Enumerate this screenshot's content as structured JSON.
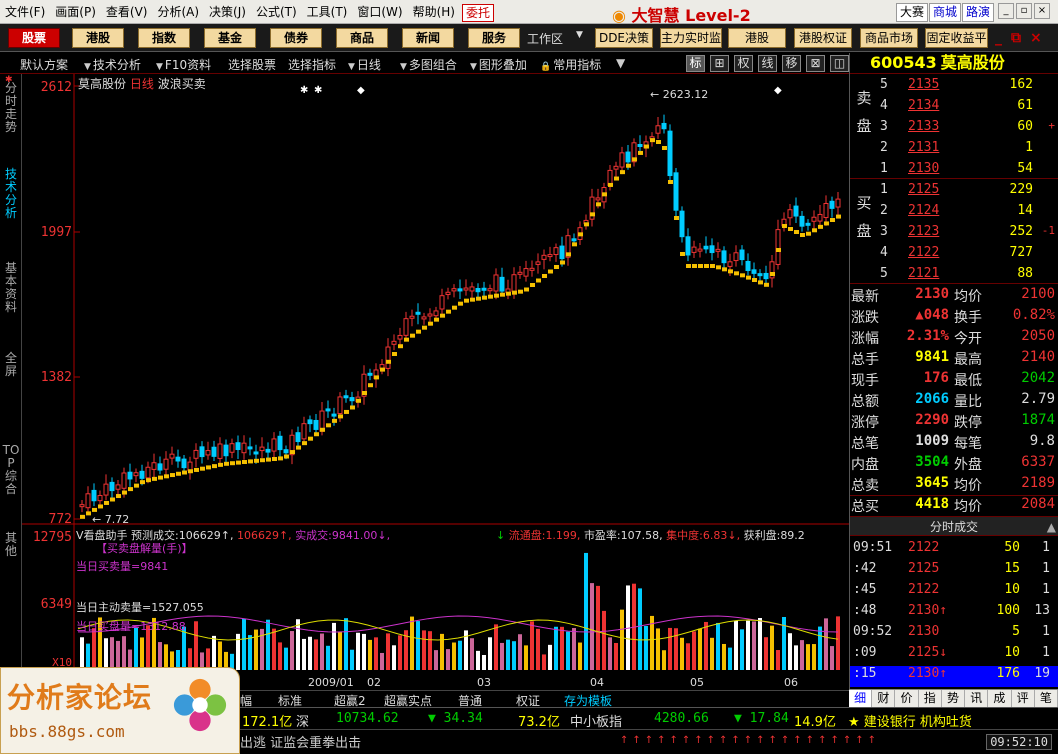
{
  "menu": {
    "items": [
      "文件(F)",
      "画面(P)",
      "查看(V)",
      "分析(A)",
      "决策(J)",
      "公式(T)",
      "工具(T)",
      "窗口(W)",
      "帮助(H)"
    ],
    "weituo": "委托",
    "brand": "大智慧 Level-2",
    "right_buttons": [
      "大赛",
      "商城",
      "路演"
    ]
  },
  "nav": {
    "buttons": [
      "股票",
      "港股",
      "指数",
      "基金",
      "债券",
      "商品",
      "新闻",
      "服务"
    ],
    "workspace_label": "工作区",
    "wide_buttons": [
      "DDE决策",
      "主力实时监",
      "港股",
      "港股权证",
      "商品市场",
      "固定收益平"
    ]
  },
  "toolbar": {
    "items": [
      "默认方案",
      "技术分析",
      "F10资料",
      "选择股票",
      "选择指标",
      "日线",
      "多图组合",
      "图形叠加",
      "常用指标"
    ],
    "icons": [
      "标",
      "⊞",
      "权",
      "线",
      "移",
      "⊠",
      "◫"
    ]
  },
  "side_tabs": [
    "分时走势",
    "技术分析",
    "基本资料",
    "全屏",
    "TOP综合",
    "其他"
  ],
  "chart": {
    "price_axis": [
      "2612",
      "1997",
      "1382",
      "772"
    ],
    "vol_axis": [
      "12795",
      "6349",
      "X10"
    ],
    "header": {
      "name": "莫高股份",
      "period": "日线",
      "indicator": "波浪买卖"
    },
    "high_label": "← 2623.12",
    "low_label": "← 7.72",
    "volhdr": {
      "a": "V看盘助手",
      "b": "预测成交:",
      "c": "106629↑,",
      "d": "106629↑,",
      "e": "实成交:",
      "f": "9841.00↓,",
      "g": "流通盘:",
      "h": "1.199,",
      "i": "市盈率:",
      "j": "107.58,",
      "k": "集中度:",
      "l": "6.83↓,",
      "m": "获利盘:",
      "n": "89.2"
    },
    "vol_sub": [
      "【买卖盘解量(手)】",
      "当日买卖量=9841",
      "当日主动卖量=1527.055",
      "当日买盘量=1312.88"
    ],
    "dates": [
      "2009/01",
      "02",
      "03",
      "04",
      "05",
      "06"
    ]
  },
  "quote": {
    "code": "600543",
    "name": "莫高股份",
    "sell_label": "卖盘",
    "buy_label": "买盘",
    "asks": [
      {
        "lv": "5",
        "price": "2135",
        "qty": "162",
        "ch": ""
      },
      {
        "lv": "4",
        "price": "2134",
        "qty": "61",
        "ch": ""
      },
      {
        "lv": "3",
        "price": "2133",
        "qty": "60",
        "ch": "+"
      },
      {
        "lv": "2",
        "price": "2131",
        "qty": "1",
        "ch": ""
      },
      {
        "lv": "1",
        "price": "2130",
        "qty": "54",
        "ch": ""
      }
    ],
    "bids": [
      {
        "lv": "1",
        "price": "2125",
        "qty": "229",
        "ch": ""
      },
      {
        "lv": "2",
        "price": "2124",
        "qty": "14",
        "ch": ""
      },
      {
        "lv": "3",
        "price": "2123",
        "qty": "252",
        "ch": "-1"
      },
      {
        "lv": "4",
        "price": "2122",
        "qty": "727",
        "ch": ""
      },
      {
        "lv": "5",
        "price": "2121",
        "qty": "88",
        "ch": ""
      }
    ],
    "stats": [
      {
        "k1": "最新",
        "v1": "2130",
        "k2": "均价",
        "v2": "2100"
      },
      {
        "k1": "涨跌",
        "v1": "▲048",
        "k2": "换手",
        "v2": "0.82%"
      },
      {
        "k1": "涨幅",
        "v1": "2.31%",
        "k2": "今开",
        "v2": "2050"
      },
      {
        "k1": "总手",
        "v1": "9841",
        "k2": "最高",
        "v2": "2140"
      },
      {
        "k1": "现手",
        "v1": "176",
        "k2": "最低",
        "v2": "2042"
      },
      {
        "k1": "总额",
        "v1": "2066",
        "k2": "量比",
        "v2": "2.79"
      },
      {
        "k1": "涨停",
        "v1": "2290",
        "k2": "跌停",
        "v2": "1874"
      },
      {
        "k1": "总笔",
        "v1": "1009",
        "k2": "每笔",
        "v2": "9.8"
      },
      {
        "k1": "内盘",
        "v1": "3504",
        "k2": "外盘",
        "v2": "6337"
      },
      {
        "k1": "总卖",
        "v1": "3645",
        "k2": "均价",
        "v2": "2189"
      },
      {
        "k1": "总买",
        "v1": "4418",
        "k2": "均价",
        "v2": "2084"
      }
    ],
    "ticks_title": "分时成交",
    "ticks": [
      {
        "t": "09:51",
        "p": "2122",
        "v": "50",
        "n": "1"
      },
      {
        "t": ":42",
        "p": "2125",
        "v": "15",
        "n": "1"
      },
      {
        "t": ":45",
        "p": "2122",
        "v": "10",
        "n": "1"
      },
      {
        "t": ":48",
        "p": "2130↑",
        "v": "100",
        "n": "13"
      },
      {
        "t": "09:52",
        "p": "2130",
        "v": "5",
        "n": "1"
      },
      {
        "t": ":09",
        "p": "2125↓",
        "v": "10",
        "n": "1"
      },
      {
        "t": ":15",
        "p": "2130↑",
        "v": "176",
        "n": "19"
      }
    ],
    "tabs": [
      "细",
      "财",
      "价",
      "指",
      "势",
      "讯",
      "成",
      "评",
      "笔"
    ]
  },
  "bottom_tabs": [
    "幅",
    "标准",
    "超赢2",
    "超赢实点",
    "普通",
    "权证",
    "存为模板"
  ],
  "status": {
    "a": "172.1亿",
    "b": "深",
    "c": "10734.62",
    "d": "▼ 34.34",
    "e": "73.2亿",
    "f": "中小板指",
    "g": "4280.66",
    "h": "▼ 17.84",
    "i": "14.9亿",
    "j": "★ 建设银行 机构吐货"
  },
  "status2": {
    "marquee": "出逃 证监会重拳出击",
    "clock": "09:52:10"
  },
  "logo": {
    "title": "分析家论坛",
    "url": "bbs.88gs.com"
  },
  "colors": {
    "up": "#e33",
    "down": "#0cf",
    "ma": "#f5c000",
    "bg": "#000000"
  }
}
